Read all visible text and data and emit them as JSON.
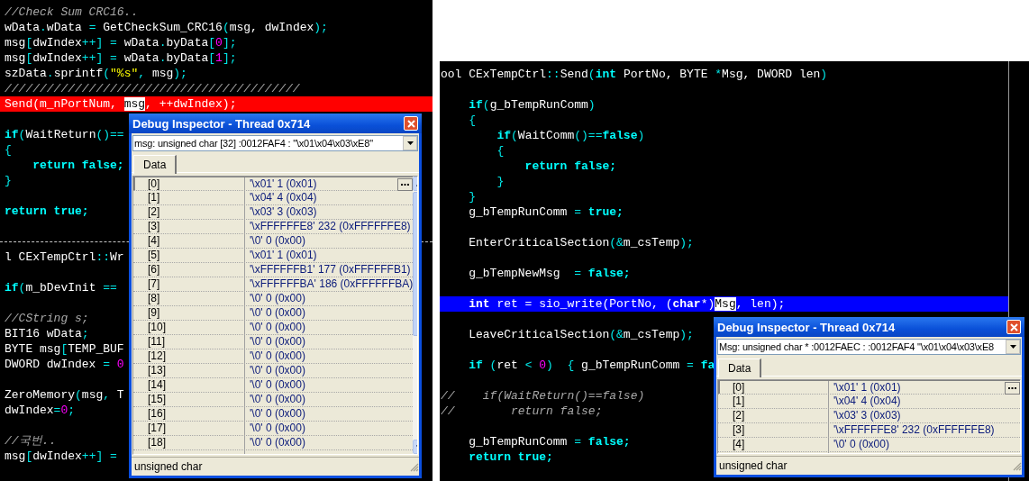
{
  "left_editor": {
    "lines": [
      {
        "kind": "code",
        "segments": [
          {
            "kind": "cm",
            "text": "//Check Sum CRC16.."
          }
        ]
      },
      {
        "kind": "code",
        "segments": [
          {
            "kind": "p",
            "text": "wData"
          },
          {
            "kind": "op",
            "text": "."
          },
          {
            "kind": "p",
            "text": "wData"
          },
          {
            "kind": "op",
            "text": " = "
          },
          {
            "kind": "p",
            "text": "GetCheckSum_CRC16"
          },
          {
            "kind": "op",
            "text": "("
          },
          {
            "kind": "p",
            "text": "msg, dwIndex"
          },
          {
            "kind": "op",
            "text": ");"
          }
        ]
      },
      {
        "kind": "code",
        "segments": [
          {
            "kind": "p",
            "text": "msg"
          },
          {
            "kind": "op",
            "text": "["
          },
          {
            "kind": "p",
            "text": "dwIndex"
          },
          {
            "kind": "op",
            "text": "++] = "
          },
          {
            "kind": "p",
            "text": "wData"
          },
          {
            "kind": "op",
            "text": "."
          },
          {
            "kind": "p",
            "text": "byData"
          },
          {
            "kind": "op",
            "text": "["
          },
          {
            "kind": "num",
            "text": "0"
          },
          {
            "kind": "op",
            "text": "];"
          }
        ]
      },
      {
        "kind": "code",
        "segments": [
          {
            "kind": "p",
            "text": "msg"
          },
          {
            "kind": "op",
            "text": "["
          },
          {
            "kind": "p",
            "text": "dwIndex"
          },
          {
            "kind": "op",
            "text": "++] = "
          },
          {
            "kind": "p",
            "text": "wData"
          },
          {
            "kind": "op",
            "text": "."
          },
          {
            "kind": "p",
            "text": "byData"
          },
          {
            "kind": "op",
            "text": "["
          },
          {
            "kind": "num",
            "text": "1"
          },
          {
            "kind": "op",
            "text": "];"
          }
        ]
      },
      {
        "kind": "code",
        "segments": [
          {
            "kind": "p",
            "text": "szData"
          },
          {
            "kind": "op",
            "text": "."
          },
          {
            "kind": "p",
            "text": "sprintf"
          },
          {
            "kind": "op",
            "text": "("
          },
          {
            "kind": "str",
            "text": "\"%s\""
          },
          {
            "kind": "op",
            "text": ", "
          },
          {
            "kind": "p",
            "text": "msg"
          },
          {
            "kind": "op",
            "text": ");"
          }
        ]
      },
      {
        "kind": "code",
        "segments": [
          {
            "kind": "cm",
            "text": "//////////////////////////////////////////"
          }
        ]
      },
      {
        "kind": "breakpoint",
        "segments": [
          {
            "kind": "p",
            "text": "Send(m_nPortNum, "
          },
          {
            "kind": "sel",
            "text": "msg"
          },
          {
            "kind": "p",
            "text": ", ++dwIndex);"
          }
        ]
      },
      {
        "kind": "gap"
      },
      {
        "kind": "code",
        "segments": [
          {
            "kind": "kw",
            "text": "if"
          },
          {
            "kind": "op",
            "text": "("
          },
          {
            "kind": "p",
            "text": "WaitReturn"
          },
          {
            "kind": "op",
            "text": "()=="
          }
        ]
      },
      {
        "kind": "code",
        "segments": [
          {
            "kind": "op",
            "text": "{"
          }
        ]
      },
      {
        "kind": "code",
        "segments": [
          {
            "kind": "kw",
            "text": "    return false;"
          }
        ]
      },
      {
        "kind": "code",
        "segments": [
          {
            "kind": "op",
            "text": "}"
          }
        ]
      },
      {
        "kind": "gap"
      },
      {
        "kind": "code",
        "segments": [
          {
            "kind": "kw",
            "text": "return true;"
          }
        ]
      },
      {
        "kind": "gap"
      },
      {
        "kind": "separator"
      },
      {
        "kind": "code",
        "segments": [
          {
            "kind": "p",
            "text": "l CExTempCtrl"
          },
          {
            "kind": "op",
            "text": "::"
          },
          {
            "kind": "p",
            "text": "Wr"
          }
        ]
      },
      {
        "kind": "gap"
      },
      {
        "kind": "code",
        "segments": [
          {
            "kind": "kw",
            "text": "if"
          },
          {
            "kind": "op",
            "text": "("
          },
          {
            "kind": "p",
            "text": "m_bDevInit "
          },
          {
            "kind": "op",
            "text": "=="
          }
        ]
      },
      {
        "kind": "gap"
      },
      {
        "kind": "code",
        "segments": [
          {
            "kind": "cm",
            "text": "//CString s;"
          }
        ]
      },
      {
        "kind": "code",
        "segments": [
          {
            "kind": "p",
            "text": "BIT16 wData"
          },
          {
            "kind": "op",
            "text": ";"
          }
        ]
      },
      {
        "kind": "code",
        "segments": [
          {
            "kind": "p",
            "text": "BYTE msg"
          },
          {
            "kind": "op",
            "text": "["
          },
          {
            "kind": "p",
            "text": "TEMP_BUF"
          }
        ]
      },
      {
        "kind": "code",
        "segments": [
          {
            "kind": "p",
            "text": "DWORD dwIndex"
          },
          {
            "kind": "op",
            "text": " = "
          },
          {
            "kind": "num",
            "text": "0"
          }
        ]
      },
      {
        "kind": "gap"
      },
      {
        "kind": "code",
        "segments": [
          {
            "kind": "p",
            "text": "ZeroMemory"
          },
          {
            "kind": "op",
            "text": "("
          },
          {
            "kind": "p",
            "text": "msg"
          },
          {
            "kind": "op",
            "text": ", "
          },
          {
            "kind": "p",
            "text": "T"
          }
        ]
      },
      {
        "kind": "code",
        "segments": [
          {
            "kind": "p",
            "text": "dwIndex"
          },
          {
            "kind": "op",
            "text": "="
          },
          {
            "kind": "num",
            "text": "0"
          },
          {
            "kind": "op",
            "text": ";"
          }
        ]
      },
      {
        "kind": "gap"
      },
      {
        "kind": "code",
        "segments": [
          {
            "kind": "cm",
            "text": "//국번.."
          }
        ]
      },
      {
        "kind": "code",
        "segments": [
          {
            "kind": "p",
            "text": "msg"
          },
          {
            "kind": "op",
            "text": "["
          },
          {
            "kind": "p",
            "text": "dwIndex"
          },
          {
            "kind": "op",
            "text": "++] ="
          }
        ]
      }
    ]
  },
  "left_inspector": {
    "title": "Debug Inspector - Thread 0x714",
    "expression": "msg: unsigned char [32] :0012FAF4 :  \"\\x01\\x04\\x03\\xE8\"",
    "tab": {
      "label": "Data",
      "selected": true
    },
    "rows": [
      {
        "index": "[0]",
        "value": "'\\x01' 1 (0x01)",
        "selected": true
      },
      {
        "index": "[1]",
        "value": "'\\x04' 4 (0x04)",
        "selected": false
      },
      {
        "index": "[2]",
        "value": "'\\x03' 3 (0x03)",
        "selected": false
      },
      {
        "index": "[3]",
        "value": "'\\xFFFFFFE8' 232 (0xFFFFFFE8)",
        "selected": false
      },
      {
        "index": "[4]",
        "value": "'\\0' 0 (0x00)",
        "selected": false
      },
      {
        "index": "[5]",
        "value": "'\\x01' 1 (0x01)",
        "selected": false
      },
      {
        "index": "[6]",
        "value": "'\\xFFFFFFB1' 177 (0xFFFFFFB1)",
        "selected": false
      },
      {
        "index": "[7]",
        "value": "'\\xFFFFFFBA' 186 (0xFFFFFFBA)",
        "selected": false
      },
      {
        "index": "[8]",
        "value": "'\\0' 0 (0x00)",
        "selected": false
      },
      {
        "index": "[9]",
        "value": "'\\0' 0 (0x00)",
        "selected": false
      },
      {
        "index": "[10]",
        "value": "'\\0' 0 (0x00)",
        "selected": false
      },
      {
        "index": "[11]",
        "value": "'\\0' 0 (0x00)",
        "selected": false
      },
      {
        "index": "[12]",
        "value": "'\\0' 0 (0x00)",
        "selected": false
      },
      {
        "index": "[13]",
        "value": "'\\0' 0 (0x00)",
        "selected": false
      },
      {
        "index": "[14]",
        "value": "'\\0' 0 (0x00)",
        "selected": false
      },
      {
        "index": "[15]",
        "value": "'\\0' 0 (0x00)",
        "selected": false
      },
      {
        "index": "[16]",
        "value": "'\\0' 0 (0x00)",
        "selected": false
      },
      {
        "index": "[17]",
        "value": "'\\0' 0 (0x00)",
        "selected": false
      },
      {
        "index": "[18]",
        "value": "'\\0' 0 (0x00)",
        "selected": false
      }
    ],
    "status": "unsigned char"
  },
  "right_editor": {
    "lines": [
      {
        "kind": "code",
        "segments": [
          {
            "kind": "p",
            "text": "ool CExTempCtrl"
          },
          {
            "kind": "op",
            "text": "::"
          },
          {
            "kind": "p",
            "text": "Send"
          },
          {
            "kind": "op",
            "text": "("
          },
          {
            "kind": "kw",
            "text": "int"
          },
          {
            "kind": "p",
            "text": " PortNo, BYTE "
          },
          {
            "kind": "op",
            "text": "*"
          },
          {
            "kind": "p",
            "text": "Msg, DWORD len"
          },
          {
            "kind": "op",
            "text": ")"
          }
        ]
      },
      {
        "kind": "gap"
      },
      {
        "kind": "code",
        "segments": [
          {
            "kind": "kw",
            "text": "    if"
          },
          {
            "kind": "op",
            "text": "("
          },
          {
            "kind": "p",
            "text": "g_bTempRunComm"
          },
          {
            "kind": "op",
            "text": ")"
          }
        ]
      },
      {
        "kind": "code",
        "segments": [
          {
            "kind": "op",
            "text": "    {"
          }
        ]
      },
      {
        "kind": "code",
        "segments": [
          {
            "kind": "kw",
            "text": "        if"
          },
          {
            "kind": "op",
            "text": "("
          },
          {
            "kind": "p",
            "text": "WaitComm"
          },
          {
            "kind": "op",
            "text": "()=="
          },
          {
            "kind": "kw",
            "text": "false"
          },
          {
            "kind": "op",
            "text": ")"
          }
        ]
      },
      {
        "kind": "code",
        "segments": [
          {
            "kind": "op",
            "text": "        {"
          }
        ]
      },
      {
        "kind": "code",
        "segments": [
          {
            "kind": "kw",
            "text": "            return false;"
          }
        ]
      },
      {
        "kind": "code",
        "segments": [
          {
            "kind": "op",
            "text": "        }"
          }
        ]
      },
      {
        "kind": "code",
        "segments": [
          {
            "kind": "op",
            "text": "    }"
          }
        ]
      },
      {
        "kind": "code",
        "segments": [
          {
            "kind": "p",
            "text": "    g_bTempRunComm"
          },
          {
            "kind": "op",
            "text": " = "
          },
          {
            "kind": "kw",
            "text": "true;"
          }
        ]
      },
      {
        "kind": "gap"
      },
      {
        "kind": "code",
        "segments": [
          {
            "kind": "p",
            "text": "    EnterCriticalSection"
          },
          {
            "kind": "op",
            "text": "(&"
          },
          {
            "kind": "p",
            "text": "m_csTemp"
          },
          {
            "kind": "op",
            "text": ");"
          }
        ]
      },
      {
        "kind": "gap"
      },
      {
        "kind": "code",
        "segments": [
          {
            "kind": "p",
            "text": "    g_bTempNewMsg"
          },
          {
            "kind": "op",
            "text": "  = "
          },
          {
            "kind": "kw",
            "text": "false;"
          }
        ]
      },
      {
        "kind": "gap"
      },
      {
        "kind": "execution",
        "segments": [
          {
            "kind": "kw",
            "text": "    int"
          },
          {
            "kind": "p",
            "text": " ret = sio_write(PortNo, ("
          },
          {
            "kind": "kw",
            "text": "char"
          },
          {
            "kind": "p",
            "text": "*)"
          },
          {
            "kind": "sel",
            "text": "Msg"
          },
          {
            "kind": "p",
            "text": ", len);"
          }
        ]
      },
      {
        "kind": "gap"
      },
      {
        "kind": "code",
        "segments": [
          {
            "kind": "p",
            "text": "    LeaveCriticalSection"
          },
          {
            "kind": "op",
            "text": "(&"
          },
          {
            "kind": "p",
            "text": "m_csTemp"
          },
          {
            "kind": "op",
            "text": ");"
          }
        ]
      },
      {
        "kind": "gap"
      },
      {
        "kind": "code",
        "segments": [
          {
            "kind": "kw",
            "text": "    if"
          },
          {
            "kind": "op",
            "text": " ("
          },
          {
            "kind": "p",
            "text": "ret "
          },
          {
            "kind": "op",
            "text": "< "
          },
          {
            "kind": "num",
            "text": "0"
          },
          {
            "kind": "op",
            "text": ")  { "
          },
          {
            "kind": "p",
            "text": "g_bTempRunComm"
          },
          {
            "kind": "op",
            "text": " = "
          },
          {
            "kind": "kw",
            "text": "fa"
          }
        ]
      },
      {
        "kind": "gap"
      },
      {
        "kind": "code",
        "segments": [
          {
            "kind": "cm",
            "text": "//    if(WaitReturn()==false)"
          }
        ]
      },
      {
        "kind": "code",
        "segments": [
          {
            "kind": "cm",
            "text": "//        return false;"
          }
        ]
      },
      {
        "kind": "gap"
      },
      {
        "kind": "code",
        "segments": [
          {
            "kind": "p",
            "text": "    g_bTempRunComm"
          },
          {
            "kind": "op",
            "text": " = "
          },
          {
            "kind": "kw",
            "text": "false;"
          }
        ]
      },
      {
        "kind": "code",
        "segments": [
          {
            "kind": "kw",
            "text": "    return true;"
          }
        ]
      }
    ]
  },
  "right_inspector": {
    "title": "Debug Inspector - Thread 0x714",
    "expression": "Msg: unsigned char * :0012FAEC : :0012FAF4 \"\\x01\\x04\\x03\\xE8",
    "tab": {
      "label": "Data",
      "selected": true
    },
    "rows": [
      {
        "index": "[0]",
        "value": "'\\x01' 1 (0x01)",
        "selected": true
      },
      {
        "index": "[1]",
        "value": "'\\x04' 4 (0x04)",
        "selected": false
      },
      {
        "index": "[2]",
        "value": "'\\x03' 3 (0x03)",
        "selected": false
      },
      {
        "index": "[3]",
        "value": "'\\xFFFFFFE8' 232 (0xFFFFFFE8)",
        "selected": false
      },
      {
        "index": "[4]",
        "value": "'\\0' 0 (0x00)",
        "selected": false
      }
    ],
    "status": "unsigned char"
  }
}
